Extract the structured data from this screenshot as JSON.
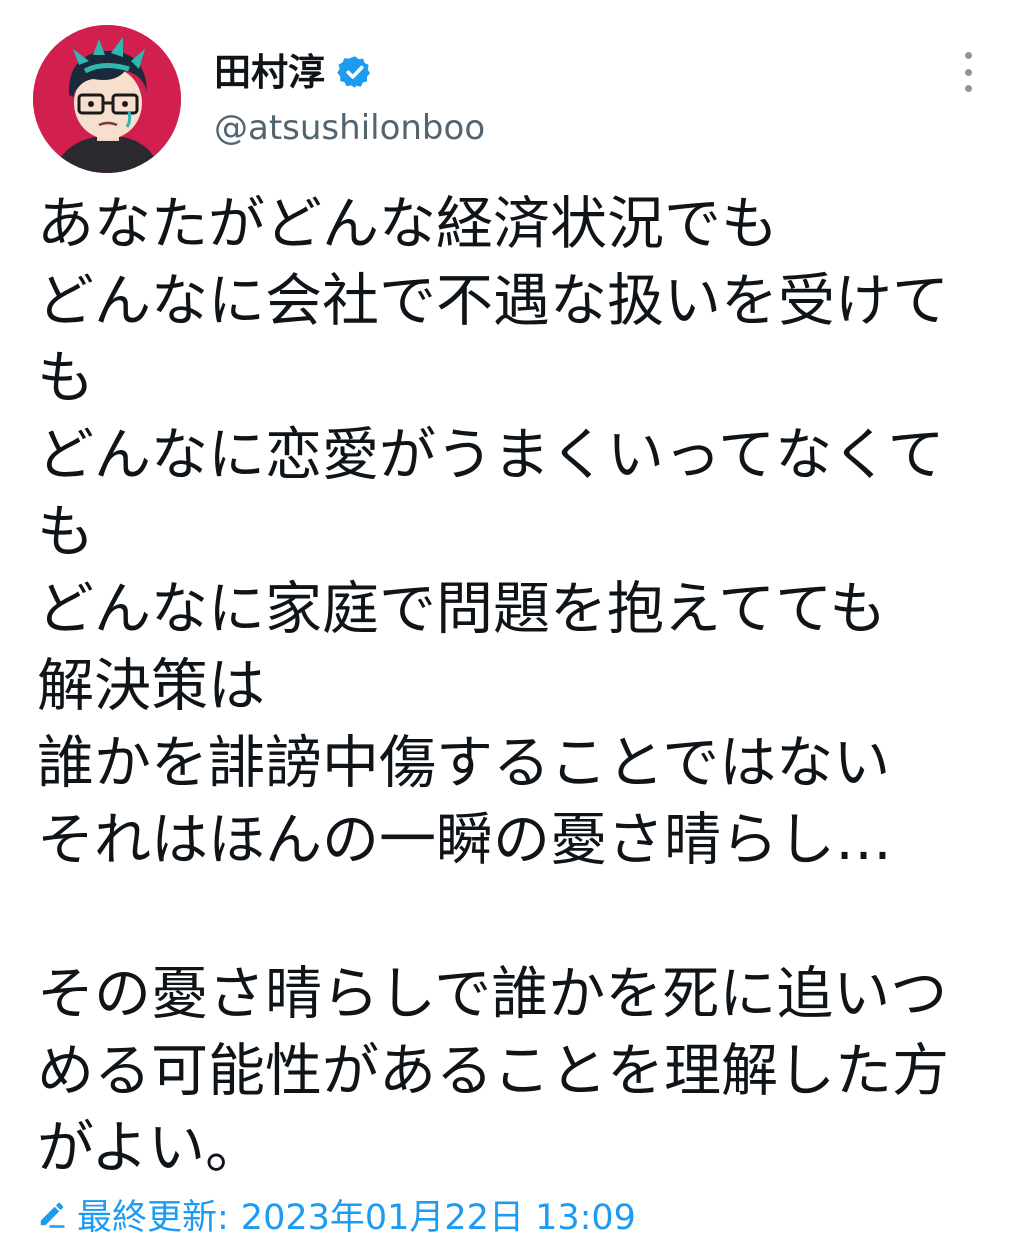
{
  "author": {
    "display_name": "田村淳",
    "handle": "@atsushilonboo",
    "verified": true
  },
  "icons": {
    "avatar": "avatar-illustration",
    "verified": "verified-badge-icon",
    "more": "more-vertical-icon",
    "edit": "pencil-icon"
  },
  "tweet": {
    "lines": [
      "あなたがどんな経済状況でも",
      "どんなに会社で不遇な扱いを受けて",
      "も",
      "どんなに恋愛がうまくいってなくて",
      "も",
      "どんなに家庭で問題を抱えてても",
      "解決策は",
      "誰かを誹謗中傷することではない",
      "それはほんの一瞬の憂さ晴らし…",
      "",
      "その憂さ晴らしで誰かを死に追いつ",
      "める可能性があることを理解した方",
      "がよい。"
    ]
  },
  "edit_info": {
    "label": "最終更新:",
    "timestamp": "2023年01月22日 13:09"
  },
  "colors": {
    "text": "#0f1419",
    "secondary_text": "#536471",
    "link_blue": "#1d9bf0",
    "avatar_bg": "#d11f4e"
  }
}
